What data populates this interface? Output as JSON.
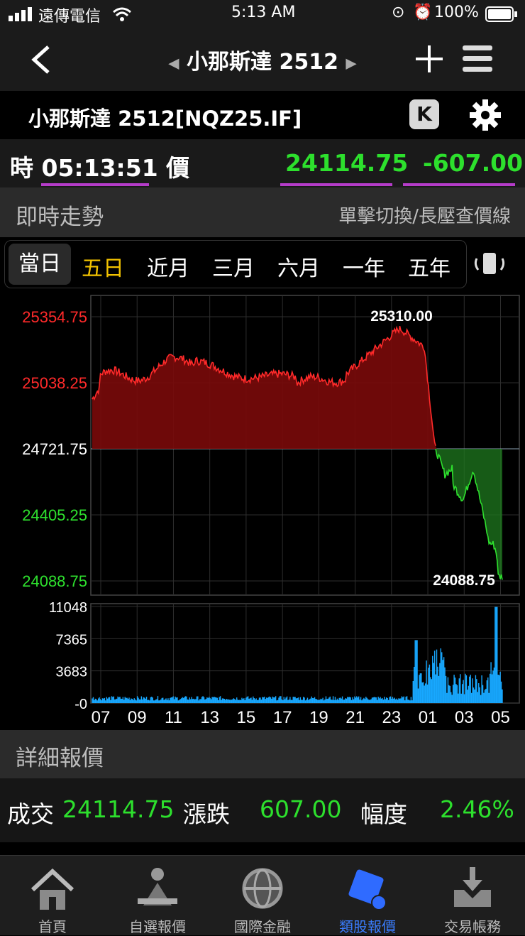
{
  "status": {
    "carrier": "遠傳電信",
    "time": "5:13 AM",
    "battery": "100%"
  },
  "nav": {
    "title": "小那斯達 2512",
    "icons": [
      "back-icon",
      "prev-icon",
      "next-icon",
      "plus-icon",
      "menu-icon"
    ]
  },
  "symbol": {
    "title": "小那斯達 2512[NQZ25.IF]",
    "k_label": "K"
  },
  "price_row": {
    "time_label": "時 05:13:51 價",
    "price": "24114.75",
    "change": "-607.00"
  },
  "section": {
    "title": "即時走勢",
    "hint": "單擊切換/長壓查價線"
  },
  "tabs": [
    {
      "label": "當日",
      "state": "selected"
    },
    {
      "label": "五日",
      "state": "highlight"
    },
    {
      "label": "近月"
    },
    {
      "label": "三月"
    },
    {
      "label": "六月"
    },
    {
      "label": "一年"
    },
    {
      "label": "五年"
    }
  ],
  "chart_data": {
    "type": "area",
    "price_axis_ticks": [
      "25354.75",
      "25038.25",
      "24721.75",
      "24405.25",
      "24088.75"
    ],
    "reference_price": 24721.75,
    "ylim": [
      24088.75,
      25354.75
    ],
    "high_label": "25310.00",
    "low_label": "24088.75",
    "volume_ticks": [
      "11048",
      "7365",
      "3683",
      "-0"
    ],
    "x_ticks": [
      "07",
      "09",
      "11",
      "13",
      "15",
      "17",
      "19",
      "21",
      "23",
      "01",
      "03",
      "05"
    ],
    "colors": {
      "above": "#ff2a2a",
      "below": "#2ee02e",
      "volume": "#18a8ff"
    }
  },
  "detail": {
    "title": "詳細報價",
    "deal_label": "成交",
    "deal_value": "24114.75",
    "chg_label": "漲跌",
    "chg_value": "607.00",
    "pct_label": "幅度",
    "pct_value": "2.46%"
  },
  "tabbar": [
    {
      "label": "首頁",
      "icon": "home-icon"
    },
    {
      "label": "自選報價",
      "icon": "watchlist-icon"
    },
    {
      "label": "國際金融",
      "icon": "globe-icon"
    },
    {
      "label": "類股報價",
      "icon": "sector-icon",
      "active": true
    },
    {
      "label": "交易帳務",
      "icon": "inbox-icon"
    }
  ]
}
